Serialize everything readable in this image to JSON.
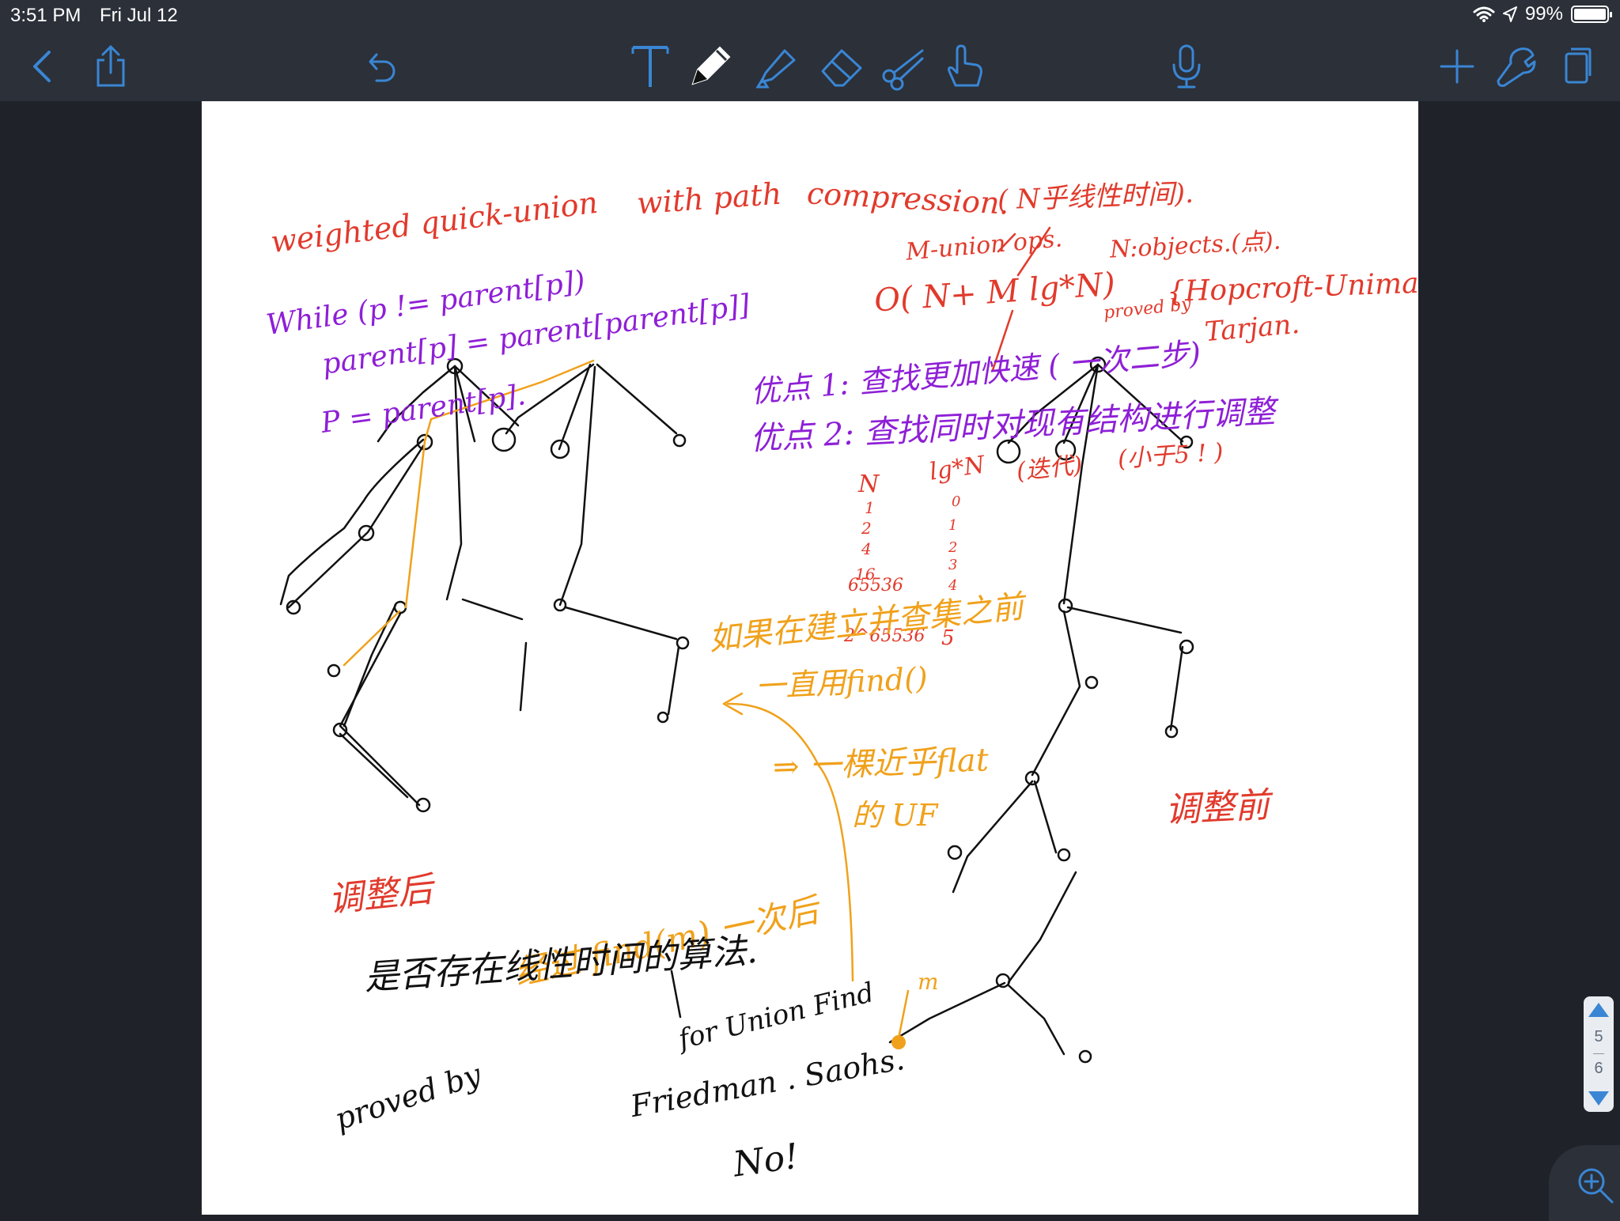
{
  "status_bar": {
    "time": "3:51 PM",
    "date": "Fri Jul 12",
    "battery": "99%"
  },
  "toolbar": {
    "left": [
      "back",
      "share",
      "undo"
    ],
    "tools": [
      "text",
      "pen",
      "highlighter",
      "eraser",
      "scissors",
      "lasso-hand"
    ],
    "right": [
      "microphone",
      "add",
      "wrench-settings",
      "pages"
    ]
  },
  "pager": {
    "current": "5",
    "total": "6"
  },
  "colors": {
    "red": "#e13a2c",
    "purple": "#8e1fd6",
    "orange": "#f0a11b",
    "black": "#111111",
    "accent": "#3a86d4"
  },
  "note": {
    "red_title": [
      "weighted quick-union",
      "with path",
      "compression.",
      "( N乎线性时间)."
    ],
    "red_complexity": [
      "M-union ops.",
      "N:objects.(点).",
      "O( N+ M lg*N)",
      "proved by",
      "{Hopcroft-Uniman",
      "Tarjan."
    ],
    "purple_code": [
      "While (p != parent[p])",
      "parent[p] = parent[parent[p]]",
      "P = parent[p]."
    ],
    "purple_pros": [
      "优点 1: 查找更加快速 ( 一次二步)",
      "优点 2: 查找同时对现有结构进行调整"
    ],
    "red_lg_table": {
      "header_n": "N",
      "header_lg": "lg*N",
      "note": "(迭代)",
      "aside": "(小于5 ! )",
      "n_values": [
        "1",
        "2",
        "4",
        "16",
        "65536",
        "2^65536"
      ],
      "lg_values": [
        "0",
        "1",
        "2",
        "3",
        "4",
        "5"
      ]
    },
    "orange_notes": [
      "如果在建立并查集之前",
      "一直用find()",
      "⇒ 一棵近乎flat",
      "的 UF",
      "经过 find(m) 一次后",
      "m"
    ],
    "red_labels": [
      "调整后",
      "调整前"
    ],
    "black_notes": [
      "是否存在线性时间的算法.",
      "for Union Find",
      "proved by",
      "Friedman . Saohs.",
      "No!"
    ]
  }
}
